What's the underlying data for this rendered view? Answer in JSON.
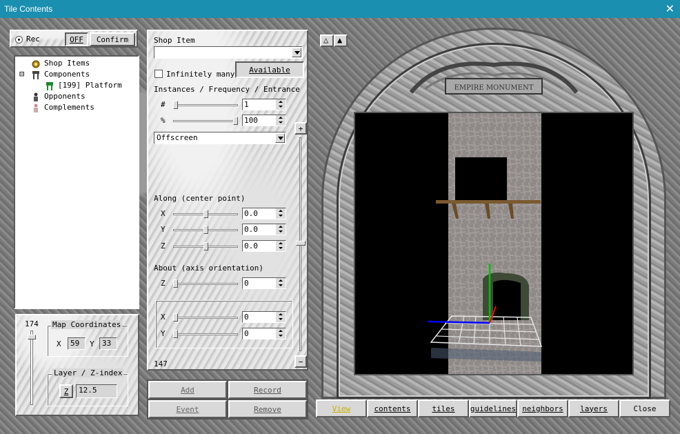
{
  "window": {
    "title": "Tile Contents",
    "close_glyph": "✕"
  },
  "rec_panel": {
    "radio_label": "Rec",
    "off_label": "OFF",
    "confirm_label": "Confirm"
  },
  "tree": {
    "items": [
      {
        "label": "Shop Items",
        "icon": "shop-items-icon"
      },
      {
        "label": "Components",
        "icon": "components-icon",
        "expander": "⊟"
      },
      {
        "label": "[199] Platform",
        "icon": "platform-icon"
      },
      {
        "label": "Opponents",
        "icon": "opponents-icon"
      },
      {
        "label": "Complements",
        "icon": "complements-icon"
      }
    ]
  },
  "coords": {
    "slider_value": "174",
    "map_title": "Map Coordinates",
    "x_label": "X",
    "x_value": "59",
    "y_label": "Y",
    "y_value": "33",
    "layer_title": "Layer / Z-index",
    "z_button": "Z",
    "z_value": "12.5"
  },
  "shop": {
    "title": "Shop Item",
    "value": "",
    "infinitely_label": "Infinitely many",
    "infinitely_checked": false,
    "available_label": "Available",
    "ife_title": "Instances / Frequency / Entrance",
    "hash_label": "#",
    "hash_value": "1",
    "hash_level": 0.0,
    "pct_label": "%",
    "pct_value": "100",
    "pct_level": 1.0,
    "entrance_value": "Offscreen",
    "along_title": "Along (center point)",
    "ax_label": "X",
    "ax_value": "0.0",
    "ax_level": 0.5,
    "ay_label": "Y",
    "ay_value": "0.0",
    "ay_level": 0.5,
    "az_label": "Z",
    "az_value": "0.0",
    "az_level": 0.5,
    "about_title": "About (axis orientation)",
    "bz_label": "Z",
    "bz_value": "0",
    "bz_level": 0.0,
    "bx_label": "X",
    "bx_value": "0",
    "bx_level": 0.0,
    "by_label": "Y",
    "by_value": "0",
    "by_level": 0.0,
    "bottom_value": "147",
    "plus": "+",
    "minus": "−"
  },
  "actions": {
    "add": "Add",
    "record": "Record",
    "event": "Event",
    "remove": "Remove"
  },
  "view": {
    "up_outline": "△",
    "up_filled": "▲",
    "plaque_text": "EMPIRE MONUMENT",
    "tabs": [
      "View",
      "contents",
      "tiles",
      "guidelines",
      "neighbors",
      "layers"
    ],
    "active_tab": "View",
    "close_label": "Close"
  },
  "colors": {
    "titlebar": "#1a8fb0",
    "active_tab": "#c9b000",
    "axis_y": "#00c000",
    "axis_x": "#0000ff",
    "axis_z": "#ff0000"
  }
}
